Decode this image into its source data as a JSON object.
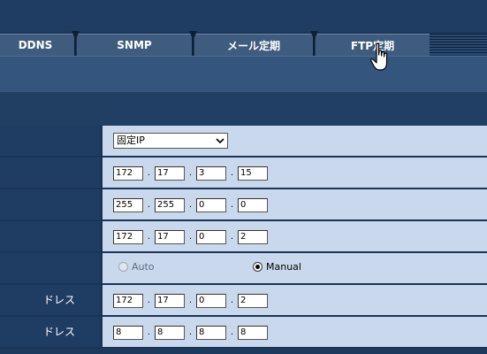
{
  "tabs": [
    {
      "label": "DDNS"
    },
    {
      "label": "SNMP"
    },
    {
      "label": "メール定期"
    },
    {
      "label": "FTP定期"
    }
  ],
  "rows": [
    {
      "label": "",
      "type": "select",
      "value": "固定IP"
    },
    {
      "label": "",
      "type": "ip",
      "octets": [
        "172",
        "17",
        "3",
        "15"
      ]
    },
    {
      "label": "",
      "type": "ip",
      "octets": [
        "255",
        "255",
        "0",
        "0"
      ]
    },
    {
      "label": "",
      "type": "ip",
      "octets": [
        "172",
        "17",
        "0",
        "2"
      ]
    },
    {
      "label": "",
      "type": "radio",
      "options": [
        "Auto",
        "Manual"
      ],
      "selected": "Manual"
    },
    {
      "label": "ドレス",
      "type": "ip",
      "octets": [
        "172",
        "17",
        "0",
        "2"
      ]
    },
    {
      "label": "ドレス",
      "type": "ip",
      "octets": [
        "8",
        "8",
        "8",
        "8"
      ]
    }
  ],
  "ip_separator": ".",
  "colors": {
    "tab_bg": "#3f5c7f",
    "row_value_bg": "#c9d8ec",
    "row_label_bg": "#1f3c62",
    "page_bg": "#1d3a5c"
  }
}
